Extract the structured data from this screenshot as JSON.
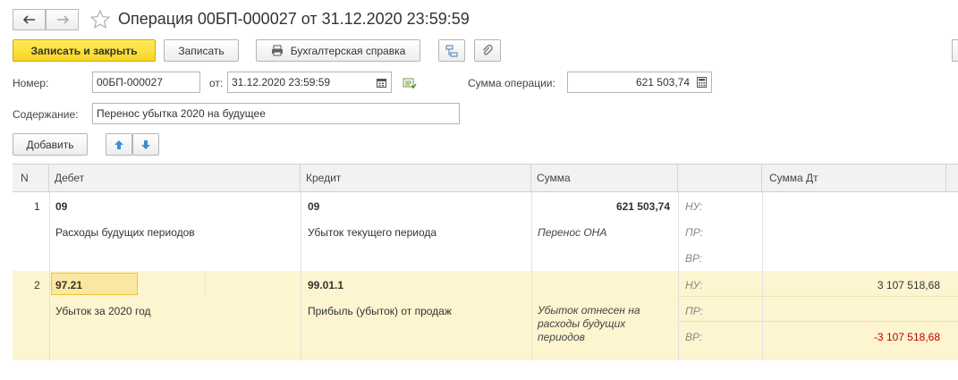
{
  "window": {
    "title": "Операция 00БП-000027 от 31.12.2020 23:59:59"
  },
  "toolbar": {
    "save_close": "Записать и закрыть",
    "save": "Записать",
    "report": "Бухгалтерская справка"
  },
  "form": {
    "number_label": "Номер:",
    "number_value": "00БП-000027",
    "date_label": "от:",
    "date_value": "31.12.2020 23:59:59",
    "sum_label": "Сумма операции:",
    "sum_value": "621 503,74",
    "content_label": "Содержание:",
    "content_value": "Перенос убытка 2020 на будущее"
  },
  "table_toolbar": {
    "add": "Добавить"
  },
  "table": {
    "headers": [
      "N",
      "Дебет",
      "Кредит",
      "Сумма",
      "",
      "Сумма Дт"
    ],
    "rows": [
      {
        "n": "1",
        "debit_account": "09",
        "debit_name": "Расходы будущих периодов",
        "credit_account": "09",
        "credit_name": "Убыток текущего периода",
        "sum": "621 503,74",
        "comment": "Перенос ОНА",
        "nu_label": "НУ:",
        "pr_label": "ПР:",
        "vr_label": "ВР:",
        "nu_value": "",
        "vr_value": ""
      },
      {
        "n": "2",
        "debit_account": "97.21",
        "debit_name": "Убыток за 2020 год",
        "credit_account": "99.01.1",
        "credit_name": "Прибыль (убыток) от продаж",
        "sum": "",
        "comment_line1": "Убыток отнесен на",
        "comment_line2": "расходы будущих",
        "comment_line3": "периодов",
        "nu_label": "НУ:",
        "pr_label": "ПР:",
        "vr_label": "ВР:",
        "nu_value": "3 107 518,68",
        "vr_value": "-3 107 518,68"
      }
    ]
  },
  "colors": {
    "primary_button": "#f7d524",
    "selected_row": "#fdf5cf",
    "negative": "#c00000"
  }
}
